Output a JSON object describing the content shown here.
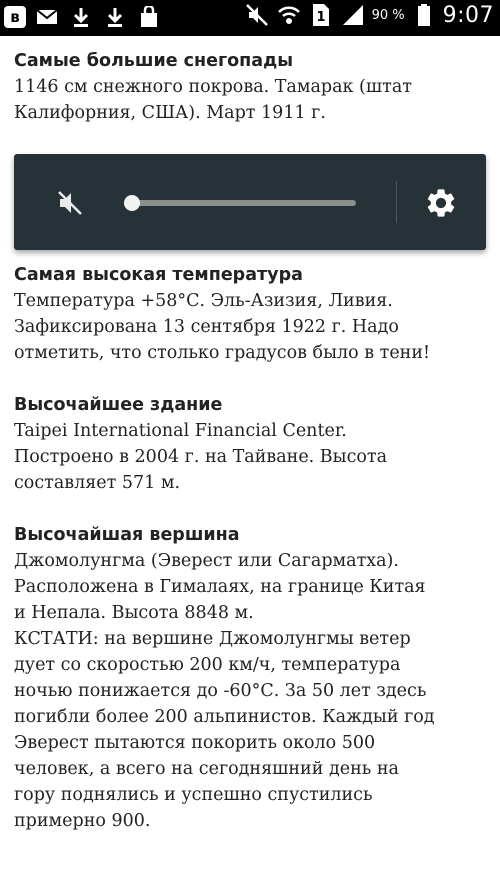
{
  "status_bar": {
    "vk_label": "в",
    "battery_text": "90 %",
    "sim_label": "1",
    "time": "9:07"
  },
  "volume": {
    "level": 0.0,
    "muted": true,
    "panel_color": "#263238"
  },
  "entries": [
    {
      "heading": "Самые большие снегопады",
      "lines": [
        "1146 см снежного покрова. Тамарак (штат",
        "Калифорния, США). Март 1911 г."
      ]
    },
    {
      "heading": "Самая высокая температура",
      "lines": [
        "Температура +58°С. Эль-Азизия, Ливия.",
        "Зафиксирована 13 сентября 1922 г. Надо",
        "отметить, что столько градусов было в тени!"
      ]
    },
    {
      "heading": "Высочайшее здание",
      "lines": [
        "Taipei International Financial Center.",
        "Построено в 2004 г. на Тайване. Высота",
        "составляет 571 м."
      ]
    },
    {
      "heading": "Высочайшая вершина",
      "lines": [
        "Джомолунгма (Эверест или Сагарматха).",
        "Расположена в Гималаях, на границе Китая",
        "и Непала. Высота 8848 м.",
        "КСТАТИ: на вершине Джомолунгмы ветер",
        "дует со скоростью 200 км/ч, температура",
        "ночью понижается до -60°С. За 50 лет здесь",
        "погибли более 200 альпинистов. Каждый год",
        "Эверест пытаются покорить около 500",
        "человек, а всего на сегодняшний день на",
        "гору поднялись и успешно спустились",
        "примерно 900."
      ]
    }
  ]
}
